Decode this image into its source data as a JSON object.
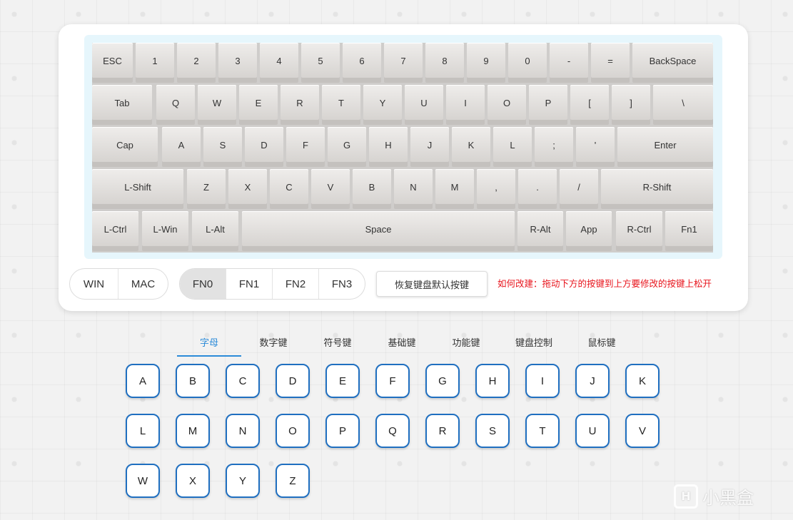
{
  "keyboard": {
    "rows": [
      [
        "ESC",
        "1",
        "2",
        "3",
        "4",
        "5",
        "6",
        "7",
        "8",
        "9",
        "0",
        "-",
        "=",
        "BackSpace"
      ],
      [
        "Tab",
        "Q",
        "W",
        "E",
        "R",
        "T",
        "Y",
        "U",
        "I",
        "O",
        "P",
        "[",
        "]",
        "\\"
      ],
      [
        "Cap",
        "A",
        "S",
        "D",
        "F",
        "G",
        "H",
        "J",
        "K",
        "L",
        ";",
        "'",
        "Enter"
      ],
      [
        "L-Shift",
        "Z",
        "X",
        "C",
        "V",
        "B",
        "N",
        "M",
        ",",
        ".",
        "/",
        "R-Shift"
      ],
      [
        "L-Ctrl",
        "L-Win",
        "L-Alt",
        "Space",
        "R-Alt",
        "App",
        "R-Ctrl",
        "Fn1"
      ]
    ]
  },
  "os_toggle": {
    "options": [
      "WIN",
      "MAC"
    ],
    "active": ""
  },
  "layer_toggle": {
    "options": [
      "FN0",
      "FN1",
      "FN2",
      "FN3"
    ],
    "active": "FN0"
  },
  "reset_button": "恢复键盘默认按键",
  "hint": "如何改建：拖动下方的按键到上方要修改的按键上松开",
  "categories": {
    "tabs": [
      "字母",
      "数字键",
      "符号键",
      "基础键",
      "功能键",
      "键盘控制",
      "鼠标键"
    ],
    "active": "字母"
  },
  "letter_keys": [
    "A",
    "B",
    "C",
    "D",
    "E",
    "F",
    "G",
    "H",
    "I",
    "J",
    "K",
    "L",
    "M",
    "N",
    "O",
    "P",
    "Q",
    "R",
    "S",
    "T",
    "U",
    "V",
    "W",
    "X",
    "Y",
    "Z"
  ],
  "watermark": {
    "logo": "H",
    "text": "小黑盒"
  },
  "colors": {
    "accent": "#2b8bd8",
    "key_border": "#1f6fc0",
    "hint": "#e8141c"
  }
}
